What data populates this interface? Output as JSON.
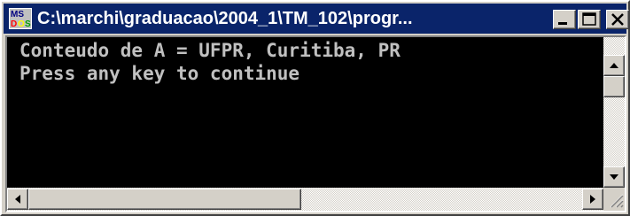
{
  "window": {
    "title": "C:\\marchi\\graduacao\\2004_1\\TM_102\\progr...",
    "icon": "ms-dos-icon",
    "title_bar_color": "#0a246a",
    "buttons": [
      "minimize",
      "maximize",
      "close"
    ]
  },
  "console": {
    "lines": [
      "Conteudo de A = UFPR, Curitiba, PR",
      "Press any key to continue"
    ],
    "background": "#000000",
    "text_color": "#c0c0c0"
  }
}
